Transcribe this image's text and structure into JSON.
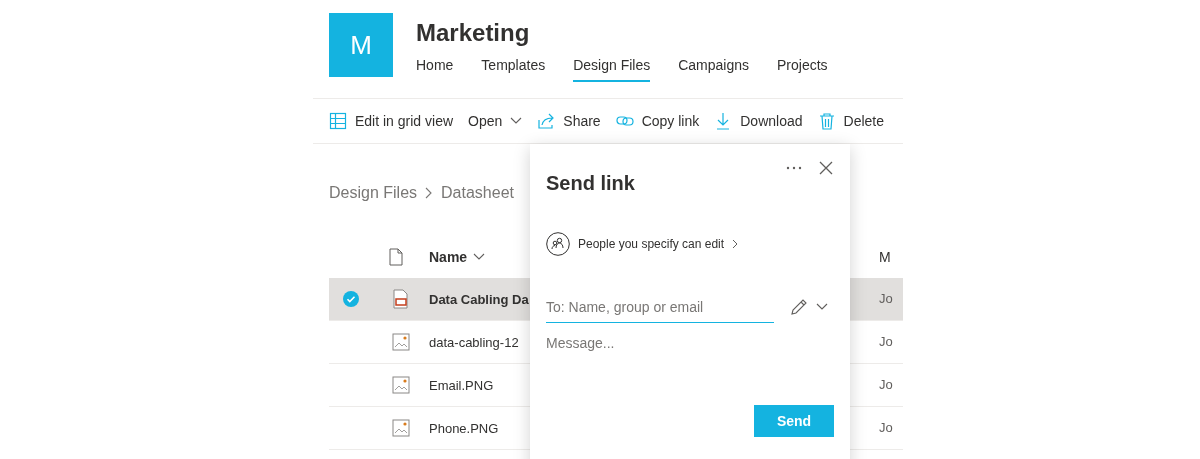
{
  "site": {
    "logo_letter": "M",
    "title": "Marketing"
  },
  "nav": [
    {
      "label": "Home",
      "selected": false
    },
    {
      "label": "Templates",
      "selected": false
    },
    {
      "label": "Design Files",
      "selected": true
    },
    {
      "label": "Campaigns",
      "selected": false
    },
    {
      "label": "Projects",
      "selected": false
    }
  ],
  "toolbar": [
    {
      "kind": "grid",
      "label": "Edit in grid view"
    },
    {
      "kind": "open",
      "label": "Open"
    },
    {
      "kind": "share",
      "label": "Share"
    },
    {
      "kind": "link",
      "label": "Copy link"
    },
    {
      "kind": "download",
      "label": "Download"
    },
    {
      "kind": "delete",
      "label": "Delete"
    }
  ],
  "breadcrumb": [
    "Design Files",
    "Datasheet"
  ],
  "table": {
    "columns": [
      "Name",
      "M"
    ],
    "rows": [
      {
        "kind": "document",
        "name": "Data Cabling Da",
        "column_2": "Jo",
        "selected": true
      },
      {
        "kind": "image",
        "name": "data-cabling-12",
        "column_2": "Jo",
        "selected": false
      },
      {
        "kind": "image",
        "name": "Email.PNG",
        "column_2": "Jo",
        "selected": false
      },
      {
        "kind": "image",
        "name": "Phone.PNG",
        "column_2": "Jo",
        "selected": false
      }
    ]
  },
  "dialog": {
    "title": "Send link",
    "permission": "People you specify can edit",
    "to_placeholder": "To: Name, group or email",
    "message_placeholder": "Message...",
    "send_button": "Send"
  }
}
